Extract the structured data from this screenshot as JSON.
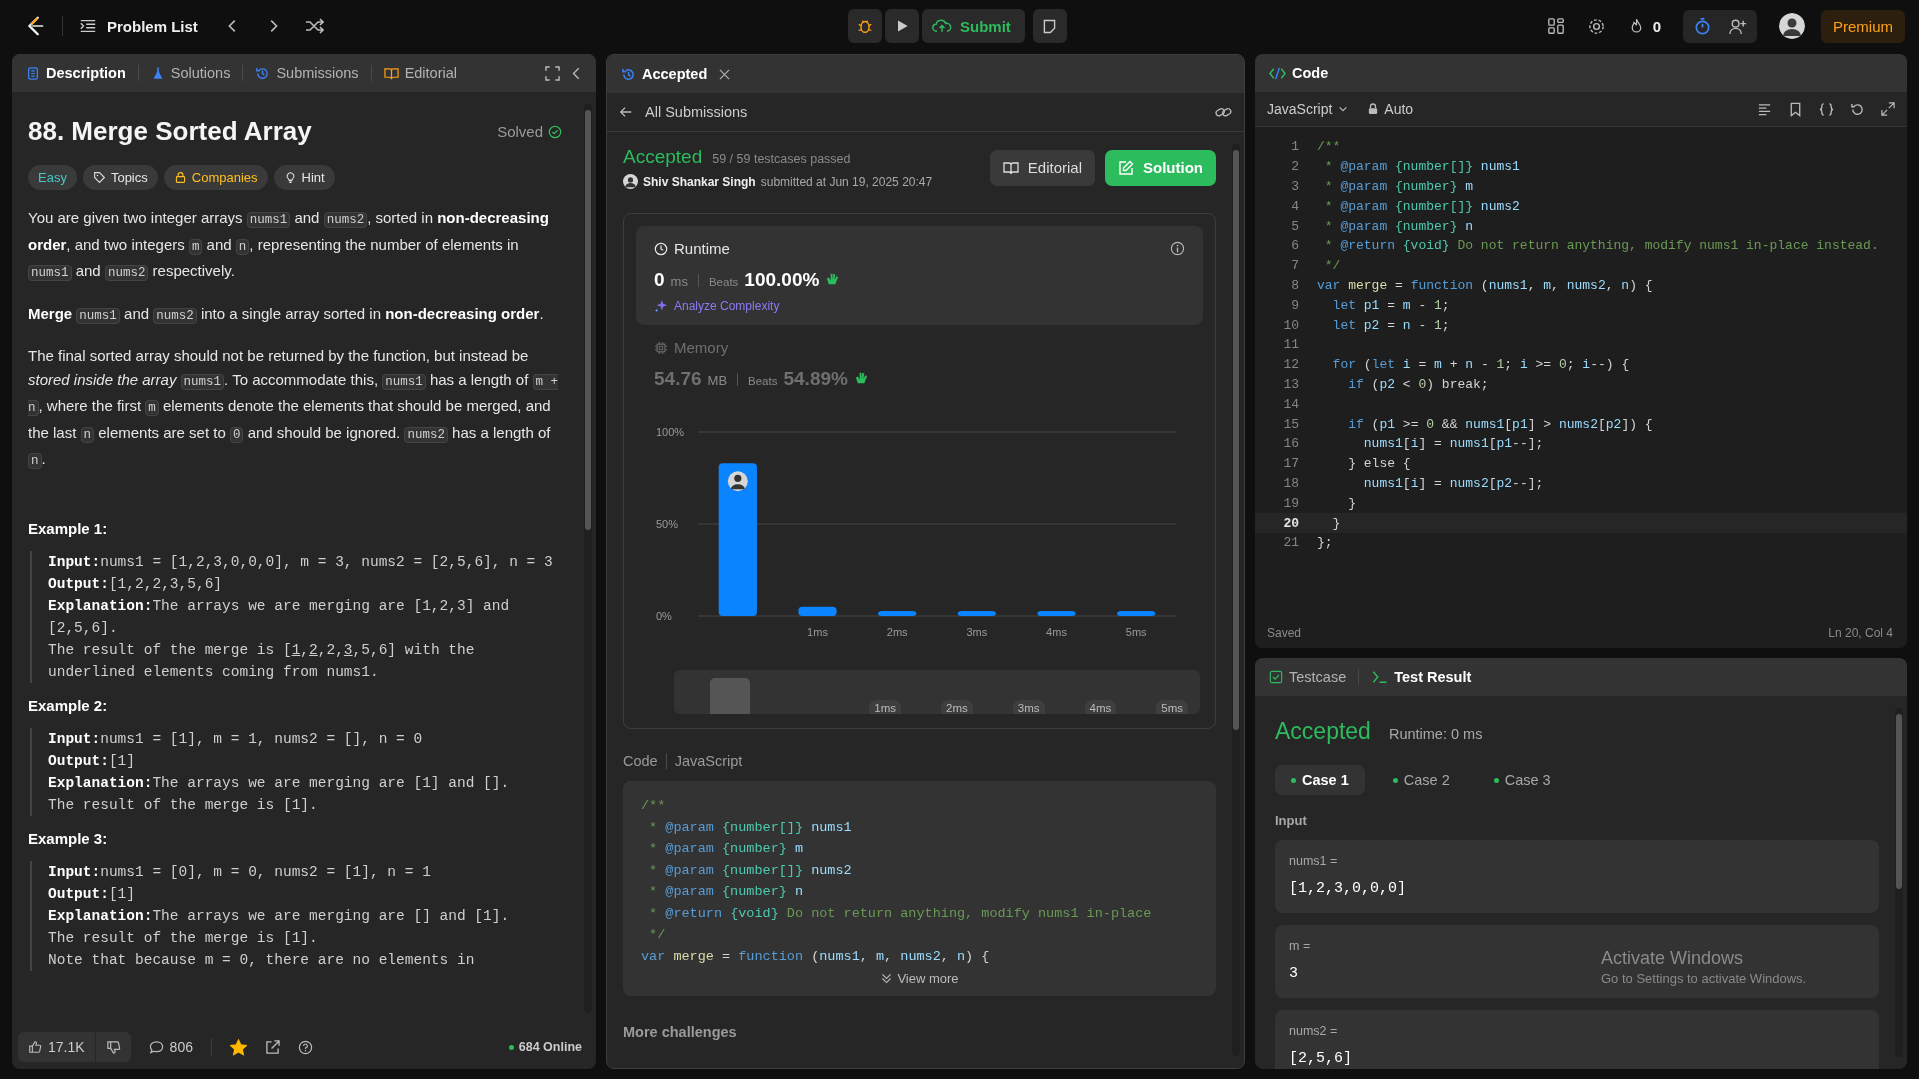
{
  "topbar": {
    "nav_label": "Problem List",
    "submit": "Submit",
    "streak": "0",
    "premium": "Premium"
  },
  "description_panel": {
    "tabs": [
      {
        "label": "Description",
        "selected": true
      },
      {
        "label": "Solutions",
        "selected": false
      },
      {
        "label": "Submissions",
        "selected": false
      },
      {
        "label": "Editorial",
        "selected": false
      }
    ],
    "title": "88. Merge Sorted Array",
    "status": "Solved",
    "tags": [
      {
        "label": "Easy",
        "kind": "difficulty"
      },
      {
        "label": "Topics",
        "kind": "topics"
      },
      {
        "label": "Companies",
        "kind": "companies"
      },
      {
        "label": "Hint",
        "kind": "hint"
      }
    ],
    "paragraphs": [
      [
        {
          "t": "You are given two integer arrays ",
          "kind": "text"
        },
        {
          "t": "nums1",
          "kind": "code"
        },
        {
          "t": " and ",
          "kind": "text"
        },
        {
          "t": "nums2",
          "kind": "code"
        },
        {
          "t": ", sorted in ",
          "kind": "text"
        },
        {
          "t": "non-decreasing order",
          "kind": "bold"
        },
        {
          "t": ", and two integers ",
          "kind": "text"
        },
        {
          "t": "m",
          "kind": "code"
        },
        {
          "t": " and ",
          "kind": "text"
        },
        {
          "t": "n",
          "kind": "code"
        },
        {
          "t": ", representing the number of elements in ",
          "kind": "text"
        },
        {
          "t": "nums1",
          "kind": "code"
        },
        {
          "t": " and ",
          "kind": "text"
        },
        {
          "t": "nums2",
          "kind": "code"
        },
        {
          "t": " respectively.",
          "kind": "text"
        }
      ],
      [
        {
          "t": "Merge ",
          "kind": "bold"
        },
        {
          "t": "nums1",
          "kind": "code"
        },
        {
          "t": " and ",
          "kind": "text"
        },
        {
          "t": "nums2",
          "kind": "code"
        },
        {
          "t": " into a single array sorted in ",
          "kind": "text"
        },
        {
          "t": "non-decreasing order",
          "kind": "bold"
        },
        {
          "t": ".",
          "kind": "text"
        }
      ],
      [
        {
          "t": "The final sorted array should not be returned by the function, but instead be ",
          "kind": "text"
        },
        {
          "t": "stored inside the array ",
          "kind": "italic"
        },
        {
          "t": "nums1",
          "kind": "code"
        },
        {
          "t": ". To accommodate this, ",
          "kind": "text"
        },
        {
          "t": "nums1",
          "kind": "code"
        },
        {
          "t": " has a length of ",
          "kind": "text"
        },
        {
          "t": "m + n",
          "kind": "code"
        },
        {
          "t": ", where the first ",
          "kind": "text"
        },
        {
          "t": "m",
          "kind": "code"
        },
        {
          "t": " elements denote the elements that should be merged, and the last ",
          "kind": "text"
        },
        {
          "t": "n",
          "kind": "code"
        },
        {
          "t": " elements are set to ",
          "kind": "text"
        },
        {
          "t": "0",
          "kind": "code"
        },
        {
          "t": " and should be ignored. ",
          "kind": "text"
        },
        {
          "t": "nums2",
          "kind": "code"
        },
        {
          "t": " has a length of ",
          "kind": "text"
        },
        {
          "t": "n",
          "kind": "code"
        },
        {
          "t": ".",
          "kind": "text"
        }
      ]
    ],
    "examples": [
      {
        "title": "Example 1:",
        "lines": [
          {
            "label": "Input:",
            "parts": [
              {
                "t": "nums1 = [1,2,3,0,0,0], m = 3, nums2 = [2,5,6], n = 3",
                "kind": "plain"
              }
            ]
          },
          {
            "label": "Output:",
            "parts": [
              {
                "t": "[1,2,2,3,5,6]",
                "kind": "plain"
              }
            ]
          },
          {
            "label": "Explanation:",
            "parts": [
              {
                "t": "The arrays we are merging are [1,2,3] and [2,5,6].",
                "kind": "plain"
              }
            ]
          },
          {
            "parts": [
              {
                "t": "The result of the merge is [",
                "kind": "plain"
              },
              {
                "t": "1",
                "kind": "underline"
              },
              {
                "t": ",",
                "kind": "plain"
              },
              {
                "t": "2",
                "kind": "underline"
              },
              {
                "t": ",2,",
                "kind": "plain"
              },
              {
                "t": "3",
                "kind": "underline"
              },
              {
                "t": ",5,6] with the underlined elements coming from nums1.",
                "kind": "plain"
              }
            ]
          }
        ]
      },
      {
        "title": "Example 2:",
        "lines": [
          {
            "label": "Input:",
            "parts": [
              {
                "t": "nums1 = [1], m = 1, nums2 = [], n = 0",
                "kind": "plain"
              }
            ]
          },
          {
            "label": "Output:",
            "parts": [
              {
                "t": "[1]",
                "kind": "plain"
              }
            ]
          },
          {
            "label": "Explanation:",
            "parts": [
              {
                "t": "The arrays we are merging are [1] and [].",
                "kind": "plain"
              }
            ]
          },
          {
            "parts": [
              {
                "t": "The result of the merge is [1].",
                "kind": "plain"
              }
            ]
          }
        ]
      },
      {
        "title": "Example 3:",
        "lines": [
          {
            "label": "Input:",
            "parts": [
              {
                "t": "nums1 = [0], m = 0, nums2 = [1], n = 1",
                "kind": "plain"
              }
            ]
          },
          {
            "label": "Output:",
            "parts": [
              {
                "t": "[1]",
                "kind": "plain"
              }
            ]
          },
          {
            "label": "Explanation:",
            "parts": [
              {
                "t": "The arrays we are merging are [] and [1].",
                "kind": "plain"
              }
            ]
          },
          {
            "parts": [
              {
                "t": "The result of the merge is [1].",
                "kind": "plain"
              }
            ]
          },
          {
            "parts": [
              {
                "t": "Note that because m = 0, there are no elements in",
                "kind": "plain"
              }
            ]
          }
        ]
      }
    ],
    "footer": {
      "likes": "17.1K",
      "comments": "806",
      "starred": true,
      "online": "684 Online"
    }
  },
  "submission_panel": {
    "tab": {
      "label": "Accepted",
      "selected": true
    },
    "back_link": "All Submissions",
    "status": "Accepted",
    "testcases": "59 / 59 testcases passed",
    "author": "Shiv Shankar Singh",
    "submitted": "submitted at Jun 19, 2025 20:47",
    "buttons": [
      {
        "label": "Editorial",
        "kind": "secondary"
      },
      {
        "label": "Solution",
        "kind": "primary"
      }
    ],
    "runtime": {
      "title": "Runtime",
      "value": "0",
      "unit": "ms",
      "beats_label": "Beats",
      "beats": "100.00%",
      "analyze": "Analyze Complexity",
      "selected": true
    },
    "memory": {
      "title": "Memory",
      "value": "54.76",
      "unit": "MB",
      "beats_label": "Beats",
      "beats": "54.89%",
      "selected": false
    },
    "chart_data": {
      "type": "bar",
      "x": [
        0,
        1,
        2,
        3,
        4,
        5
      ],
      "values": [
        83,
        5,
        2,
        2,
        2,
        2
      ],
      "xlim": [
        -0.5,
        5.5
      ],
      "ylim": [
        0,
        100
      ],
      "yticks": [
        {
          "value": 0,
          "label": "0%"
        },
        {
          "value": 50,
          "label": "50%"
        },
        {
          "value": 100,
          "label": "100%"
        }
      ],
      "xticks": [
        {
          "value": 1,
          "label": "1ms"
        },
        {
          "value": 2,
          "label": "2ms"
        },
        {
          "value": 3,
          "label": "3ms"
        },
        {
          "value": 4,
          "label": "4ms"
        },
        {
          "value": 5,
          "label": "5ms"
        }
      ]
    },
    "overview_labels": [
      "1ms",
      "2ms",
      "3ms",
      "4ms",
      "5ms"
    ],
    "code_label": "Code",
    "language": "JavaScript",
    "code_lines": [
      [
        {
          "t": "/**",
          "kind": "cm"
        }
      ],
      [
        {
          "t": " * ",
          "kind": "cm"
        },
        {
          "t": "@param",
          "kind": "tg"
        },
        {
          "t": " {number[]}",
          "kind": "ty"
        },
        {
          "t": " nums1",
          "kind": "id"
        }
      ],
      [
        {
          "t": " * ",
          "kind": "cm"
        },
        {
          "t": "@param",
          "kind": "tg"
        },
        {
          "t": " {number}",
          "kind": "ty"
        },
        {
          "t": " m",
          "kind": "id"
        }
      ],
      [
        {
          "t": " * ",
          "kind": "cm"
        },
        {
          "t": "@param",
          "kind": "tg"
        },
        {
          "t": " {number[]}",
          "kind": "ty"
        },
        {
          "t": " nums2",
          "kind": "id"
        }
      ],
      [
        {
          "t": " * ",
          "kind": "cm"
        },
        {
          "t": "@param",
          "kind": "tg"
        },
        {
          "t": " {number}",
          "kind": "ty"
        },
        {
          "t": " n",
          "kind": "id"
        }
      ],
      [
        {
          "t": " * ",
          "kind": "cm"
        },
        {
          "t": "@return",
          "kind": "tg"
        },
        {
          "t": " {void}",
          "kind": "ty"
        },
        {
          "t": " Do not return anything, modify nums1 in-place",
          "kind": "cm"
        }
      ],
      [
        {
          "t": " */",
          "kind": "cm"
        }
      ],
      [
        {
          "t": "var",
          "kind": "kw"
        },
        {
          "t": " merge",
          "kind": "fn"
        },
        {
          "t": " = ",
          "kind": "tx"
        },
        {
          "t": "function",
          "kind": "kw"
        },
        {
          "t": " (",
          "kind": "tx"
        },
        {
          "t": "nums1",
          "kind": "id"
        },
        {
          "t": ", ",
          "kind": "tx"
        },
        {
          "t": "m",
          "kind": "id"
        },
        {
          "t": ", ",
          "kind": "tx"
        },
        {
          "t": "nums2",
          "kind": "id"
        },
        {
          "t": ", ",
          "kind": "tx"
        },
        {
          "t": "n",
          "kind": "id"
        },
        {
          "t": ") {",
          "kind": "tx"
        }
      ]
    ],
    "view_more": "View more",
    "more_challenges": "More challenges"
  },
  "editor": {
    "title": "Code",
    "language": "JavaScript",
    "mode": "Auto",
    "lines": [
      {
        "number": "1",
        "active": false,
        "tokens": [
          {
            "t": "/**",
            "kind": "cm"
          }
        ]
      },
      {
        "number": "2",
        "active": false,
        "tokens": [
          {
            "t": " * ",
            "kind": "cm"
          },
          {
            "t": "@param",
            "kind": "tg"
          },
          {
            "t": " {number[]}",
            "kind": "ty"
          },
          {
            "t": " nums1",
            "kind": "id"
          }
        ]
      },
      {
        "number": "3",
        "active": false,
        "tokens": [
          {
            "t": " * ",
            "kind": "cm"
          },
          {
            "t": "@param",
            "kind": "tg"
          },
          {
            "t": " {number}",
            "kind": "ty"
          },
          {
            "t": " m",
            "kind": "id"
          }
        ]
      },
      {
        "number": "4",
        "active": false,
        "tokens": [
          {
            "t": " * ",
            "kind": "cm"
          },
          {
            "t": "@param",
            "kind": "tg"
          },
          {
            "t": " {number[]}",
            "kind": "ty"
          },
          {
            "t": " nums2",
            "kind": "id"
          }
        ]
      },
      {
        "number": "5",
        "active": false,
        "tokens": [
          {
            "t": " * ",
            "kind": "cm"
          },
          {
            "t": "@param",
            "kind": "tg"
          },
          {
            "t": " {number}",
            "kind": "ty"
          },
          {
            "t": " n",
            "kind": "id"
          }
        ]
      },
      {
        "number": "6",
        "active": false,
        "tokens": [
          {
            "t": " * ",
            "kind": "cm"
          },
          {
            "t": "@return",
            "kind": "tg"
          },
          {
            "t": " {void}",
            "kind": "ty"
          },
          {
            "t": " Do not return anything, modify nums1 in-place instead.",
            "kind": "cm"
          }
        ]
      },
      {
        "number": "7",
        "active": false,
        "tokens": [
          {
            "t": " */",
            "kind": "cm"
          }
        ]
      },
      {
        "number": "8",
        "active": false,
        "tokens": [
          {
            "t": "var",
            "kind": "kw"
          },
          {
            "t": " merge",
            "kind": "fn"
          },
          {
            "t": " = ",
            "kind": "tx"
          },
          {
            "t": "function",
            "kind": "kw"
          },
          {
            "t": " (",
            "kind": "tx"
          },
          {
            "t": "nums1",
            "kind": "id"
          },
          {
            "t": ", ",
            "kind": "tx"
          },
          {
            "t": "m",
            "kind": "id"
          },
          {
            "t": ", ",
            "kind": "tx"
          },
          {
            "t": "nums2",
            "kind": "id"
          },
          {
            "t": ", ",
            "kind": "tx"
          },
          {
            "t": "n",
            "kind": "id"
          },
          {
            "t": ") {",
            "kind": "tx"
          }
        ]
      },
      {
        "number": "9",
        "active": false,
        "tokens": [
          {
            "t": "  let",
            "kind": "kw"
          },
          {
            "t": " p1",
            "kind": "id"
          },
          {
            "t": " = ",
            "kind": "tx"
          },
          {
            "t": "m",
            "kind": "id"
          },
          {
            "t": " - ",
            "kind": "tx"
          },
          {
            "t": "1",
            "kind": "nu"
          },
          {
            "t": ";",
            "kind": "tx"
          }
        ]
      },
      {
        "number": "10",
        "active": false,
        "tokens": [
          {
            "t": "  let",
            "kind": "kw"
          },
          {
            "t": " p2",
            "kind": "id"
          },
          {
            "t": " = ",
            "kind": "tx"
          },
          {
            "t": "n",
            "kind": "id"
          },
          {
            "t": " - ",
            "kind": "tx"
          },
          {
            "t": "1",
            "kind": "nu"
          },
          {
            "t": ";",
            "kind": "tx"
          }
        ]
      },
      {
        "number": "11",
        "active": false
      },
      {
        "number": "12",
        "active": false,
        "tokens": [
          {
            "t": "  for",
            "kind": "kw"
          },
          {
            "t": " (",
            "kind": "tx"
          },
          {
            "t": "let",
            "kind": "kw"
          },
          {
            "t": " i",
            "kind": "id"
          },
          {
            "t": " = ",
            "kind": "tx"
          },
          {
            "t": "m",
            "kind": "id"
          },
          {
            "t": " + ",
            "kind": "tx"
          },
          {
            "t": "n",
            "kind": "id"
          },
          {
            "t": " - ",
            "kind": "tx"
          },
          {
            "t": "1",
            "kind": "nu"
          },
          {
            "t": "; ",
            "kind": "tx"
          },
          {
            "t": "i",
            "kind": "id"
          },
          {
            "t": " >= ",
            "kind": "tx"
          },
          {
            "t": "0",
            "kind": "nu"
          },
          {
            "t": "; ",
            "kind": "tx"
          },
          {
            "t": "i",
            "kind": "id"
          },
          {
            "t": "--) {",
            "kind": "tx"
          }
        ]
      },
      {
        "number": "13",
        "active": false,
        "tokens": [
          {
            "t": "    if",
            "kind": "kw"
          },
          {
            "t": " (",
            "kind": "tx"
          },
          {
            "t": "p2",
            "kind": "id"
          },
          {
            "t": " < ",
            "kind": "tx"
          },
          {
            "t": "0",
            "kind": "nu"
          },
          {
            "t": ") break;",
            "kind": "tx"
          }
        ]
      },
      {
        "number": "14",
        "active": false
      },
      {
        "number": "15",
        "active": false,
        "tokens": [
          {
            "t": "    if",
            "kind": "kw"
          },
          {
            "t": " (",
            "kind": "tx"
          },
          {
            "t": "p1",
            "kind": "id"
          },
          {
            "t": " >= ",
            "kind": "tx"
          },
          {
            "t": "0",
            "kind": "nu"
          },
          {
            "t": " && ",
            "kind": "tx"
          },
          {
            "t": "nums1",
            "kind": "id"
          },
          {
            "t": "[",
            "kind": "tx"
          },
          {
            "t": "p1",
            "kind": "id"
          },
          {
            "t": "] > ",
            "kind": "tx"
          },
          {
            "t": "nums2",
            "kind": "id"
          },
          {
            "t": "[",
            "kind": "tx"
          },
          {
            "t": "p2",
            "kind": "id"
          },
          {
            "t": "]) {",
            "kind": "tx"
          }
        ]
      },
      {
        "number": "16",
        "active": false,
        "tokens": [
          {
            "t": "      nums1",
            "kind": "id"
          },
          {
            "t": "[",
            "kind": "tx"
          },
          {
            "t": "i",
            "kind": "id"
          },
          {
            "t": "] = ",
            "kind": "tx"
          },
          {
            "t": "nums1",
            "kind": "id"
          },
          {
            "t": "[",
            "kind": "tx"
          },
          {
            "t": "p1",
            "kind": "id"
          },
          {
            "t": "--];",
            "kind": "tx"
          }
        ]
      },
      {
        "number": "17",
        "active": false,
        "tokens": [
          {
            "t": "    } else {",
            "kind": "tx"
          }
        ]
      },
      {
        "number": "18",
        "active": false,
        "tokens": [
          {
            "t": "      nums1",
            "kind": "id"
          },
          {
            "t": "[",
            "kind": "tx"
          },
          {
            "t": "i",
            "kind": "id"
          },
          {
            "t": "] = ",
            "kind": "tx"
          },
          {
            "t": "nums2",
            "kind": "id"
          },
          {
            "t": "[",
            "kind": "tx"
          },
          {
            "t": "p2",
            "kind": "id"
          },
          {
            "t": "--];",
            "kind": "tx"
          }
        ]
      },
      {
        "number": "19",
        "active": false,
        "tokens": [
          {
            "t": "    }",
            "kind": "tx"
          }
        ]
      },
      {
        "number": "20",
        "active": true,
        "tokens": [
          {
            "t": "  }",
            "kind": "tx"
          }
        ]
      },
      {
        "number": "21",
        "active": false,
        "tokens": [
          {
            "t": "};",
            "kind": "tx"
          }
        ]
      }
    ],
    "saved": "Saved",
    "cursor": "Ln 20, Col 4"
  },
  "result_panel": {
    "tabs": [
      {
        "label": "Testcase",
        "selected": false
      },
      {
        "label": "Test Result",
        "selected": true
      }
    ],
    "status": "Accepted",
    "runtime": "Runtime: 0 ms",
    "cases": [
      {
        "label": "Case 1",
        "selected": true
      },
      {
        "label": "Case 2",
        "selected": false
      },
      {
        "label": "Case 3",
        "selected": false
      }
    ],
    "input_label": "Input",
    "inputs": [
      {
        "name": "nums1 =",
        "value": "[1,2,3,0,0,0]"
      },
      {
        "name": "m =",
        "value": "3"
      },
      {
        "name": "nums2 =",
        "value": "[2,5,6]"
      }
    ]
  },
  "os_watermark": {
    "title": "Activate Windows",
    "subtitle": "Go to Settings to activate Windows."
  }
}
